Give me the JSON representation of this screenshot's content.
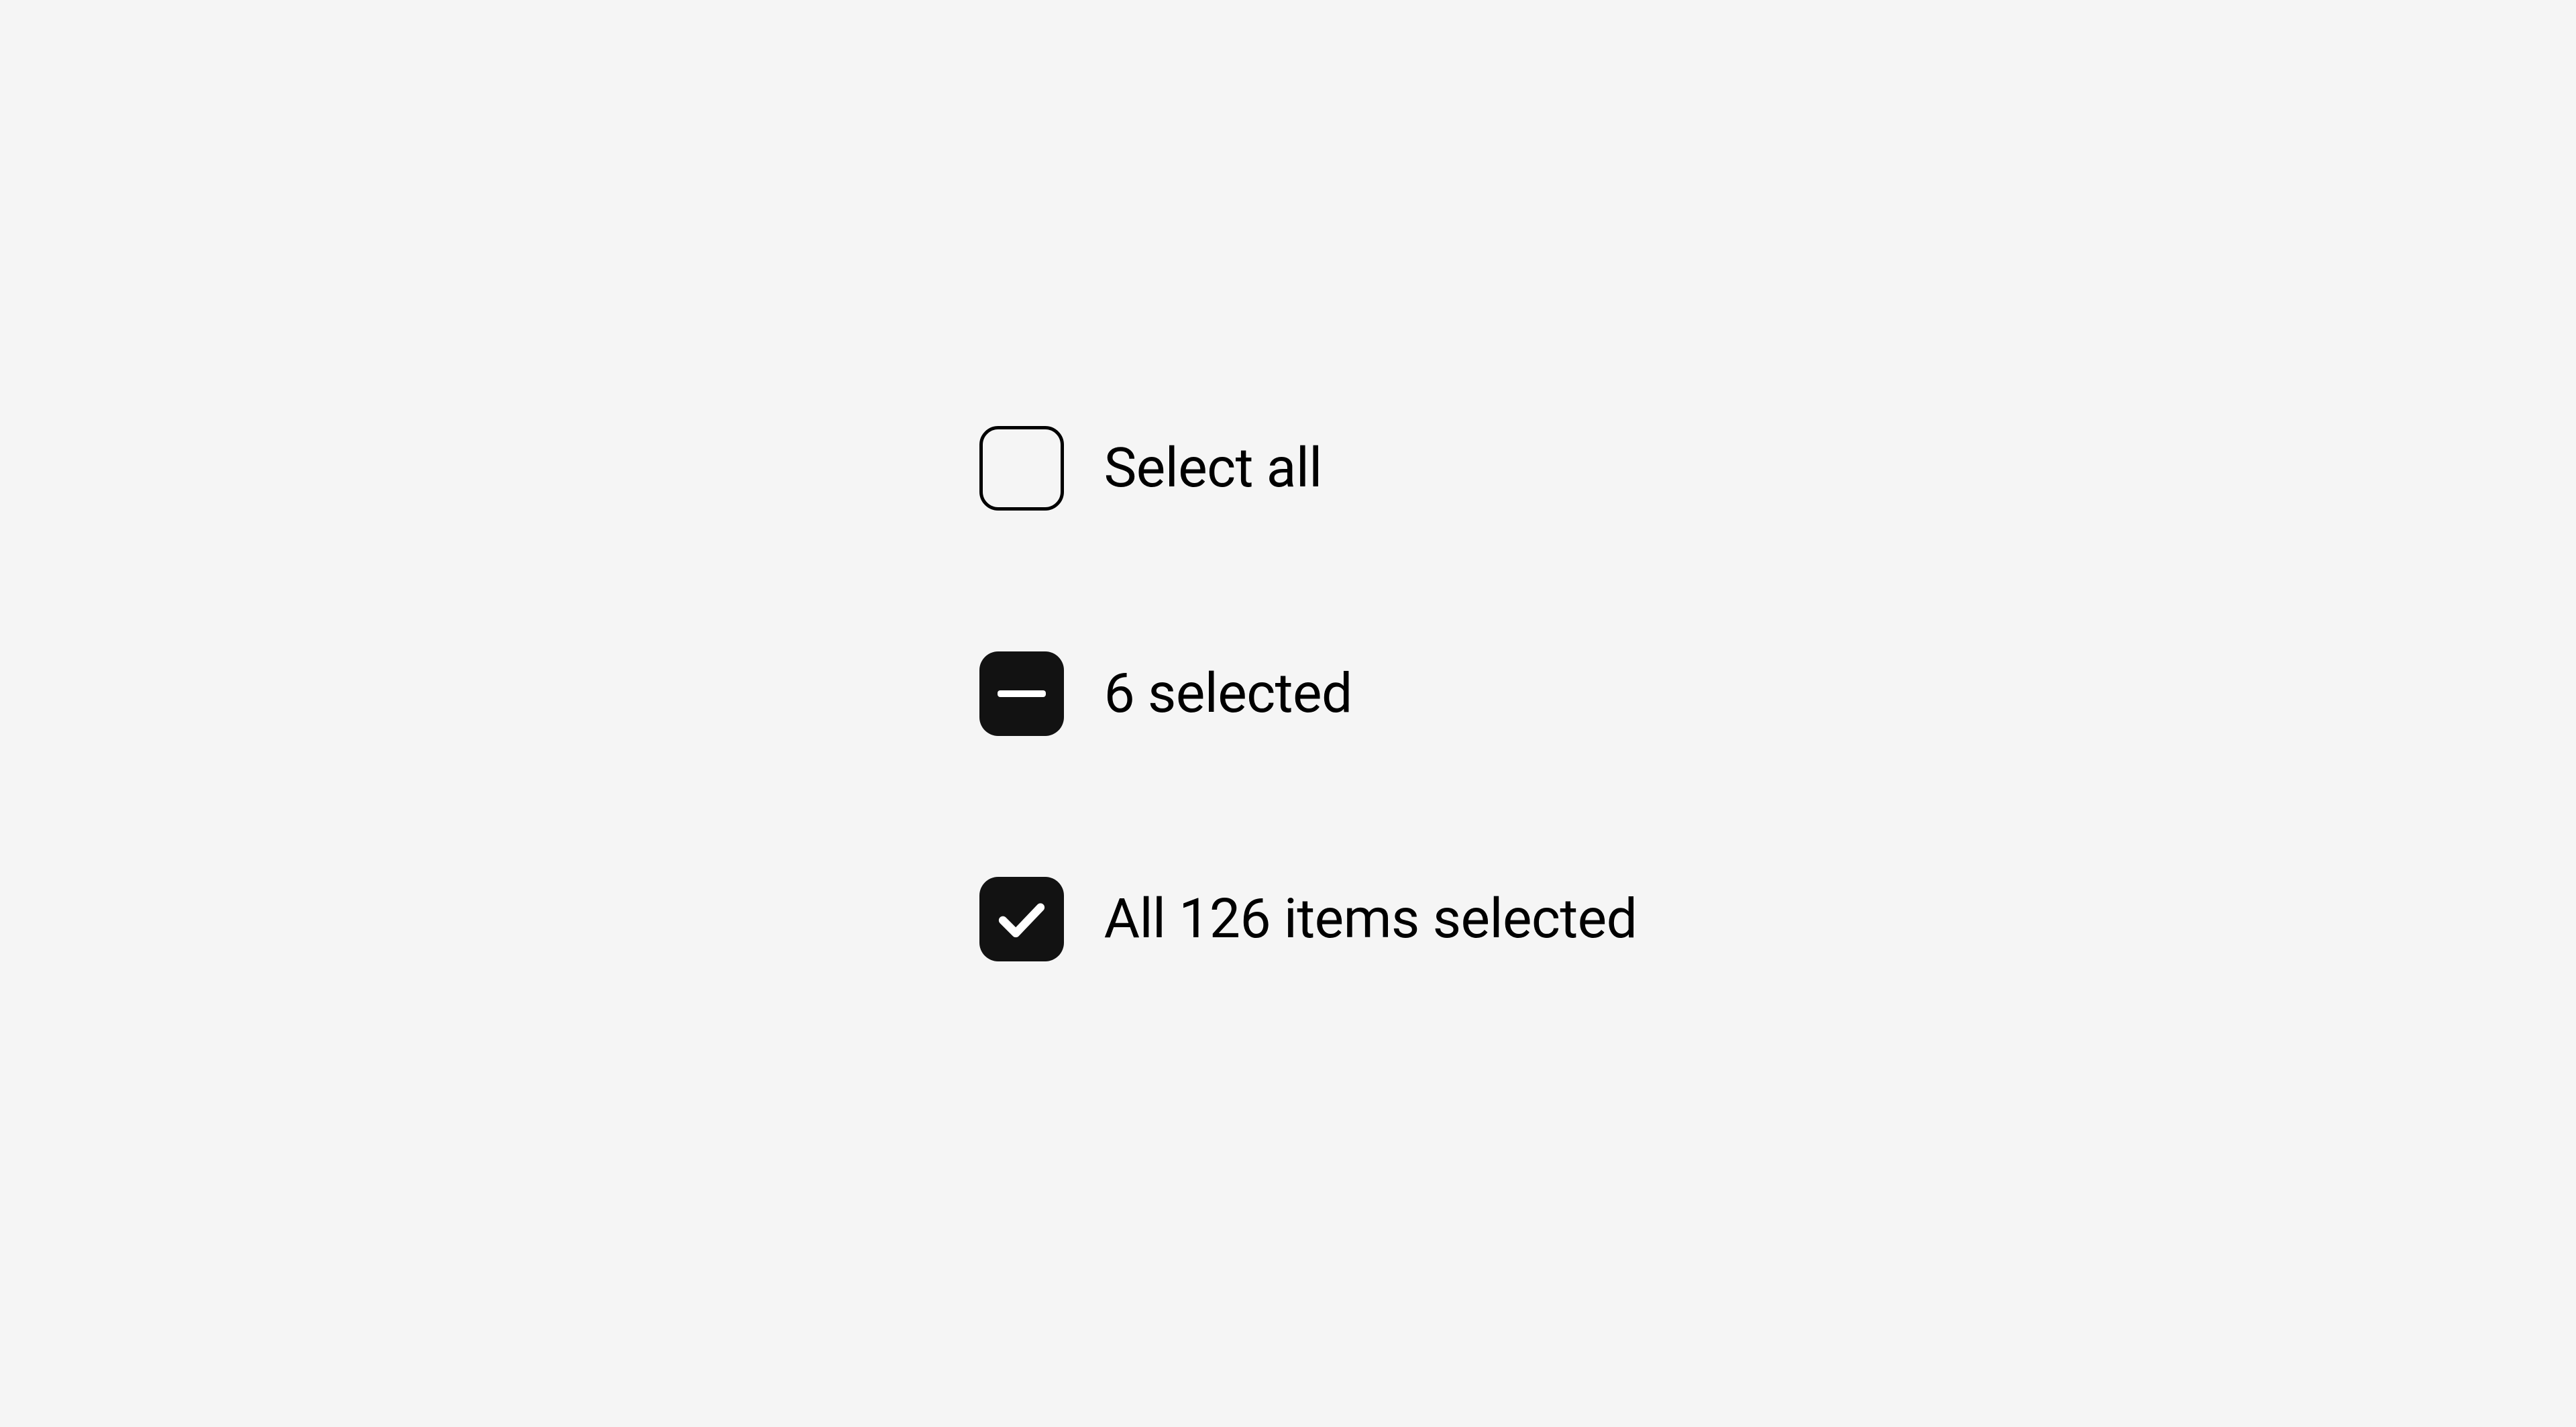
{
  "checkboxes": {
    "unchecked": {
      "label": "Select all"
    },
    "indeterminate": {
      "label": "6 selected"
    },
    "checked": {
      "label": "All 126 items selected"
    }
  }
}
